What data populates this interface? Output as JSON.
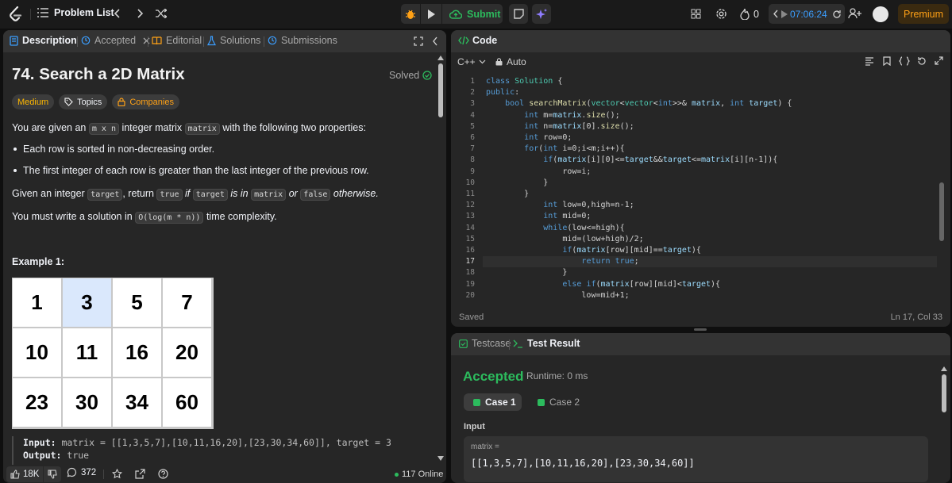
{
  "topbar": {
    "problem_list": "Problem List",
    "submit": "Submit",
    "streak": "0",
    "timer": "07:06:24",
    "premium": "Premium"
  },
  "left_tabs": {
    "description": "Description",
    "accepted": "Accepted",
    "editorial": "Editorial",
    "solutions": "Solutions",
    "submissions": "Submissions"
  },
  "problem": {
    "title": "74. Search a 2D Matrix",
    "solved": "Solved",
    "tags": {
      "difficulty": "Medium",
      "topics": "Topics",
      "companies": "Companies"
    },
    "p1_a": "You are given an",
    "p1_code1": "m x n",
    "p1_b": "integer matrix",
    "p1_code2": "matrix",
    "p1_c": "with the following two properties:",
    "bullet1": "Each row is sorted in non-decreasing order.",
    "bullet2": "The first integer of each row is greater than the last integer of the previous row.",
    "p2_a": "Given an integer",
    "p2_code1": "target",
    "p2_b": ", return",
    "p2_code2": "true",
    "p2_c": "if",
    "p2_code3": "target",
    "p2_d": "is in",
    "p2_code4": "matrix",
    "p2_e": "or",
    "p2_code5": "false",
    "p2_f": "otherwise.",
    "p3_a": "You must write a solution in",
    "p3_code": "O(log(m * n))",
    "p3_b": "time complexity.",
    "example_heading": "Example 1:",
    "matrix_cells": [
      "1",
      "3",
      "5",
      "7",
      "10",
      "11",
      "16",
      "20",
      "23",
      "30",
      "34",
      "60"
    ],
    "input_label": "Input:",
    "input_value": "matrix = [[1,3,5,7],[10,11,16,20],[23,30,34,60]], target = 3",
    "output_label": "Output:",
    "output_value": "true"
  },
  "left_footer": {
    "likes": "18K",
    "comments": "372",
    "online": "117 Online"
  },
  "code_panel": {
    "title": "Code",
    "language": "C++",
    "mode": "Auto",
    "saved": "Saved",
    "cursor": "Ln 17, Col 33",
    "line_numbers": [
      "1",
      "2",
      "3",
      "4",
      "5",
      "6",
      "7",
      "8",
      "9",
      "10",
      "11",
      "12",
      "13",
      "14",
      "15",
      "16",
      "17",
      "18",
      "19",
      "20"
    ],
    "lines": [
      "class Solution {",
      "public:",
      "    bool searchMatrix(vector<vector<int>>& matrix, int target) {",
      "        int m=matrix.size();",
      "        int n=matrix[0].size();",
      "        int row=0;",
      "        for(int i=0;i<m;i++){",
      "            if(matrix[i][0]<=target&&target<=matrix[i][n-1]){",
      "                row=i;",
      "            }",
      "        }",
      "            int low=0,high=n-1;",
      "            int mid=0;",
      "            while(low<=high){",
      "                mid=(low+high)/2;",
      "                if(matrix[row][mid]==target){",
      "                    return true;",
      "                }",
      "                else if(matrix[row][mid]<target){",
      "                    low=mid+1;"
    ]
  },
  "result_panel": {
    "tab_testcase": "Testcase",
    "tab_result": "Test Result",
    "status": "Accepted",
    "runtime": "Runtime: 0 ms",
    "case1": "Case 1",
    "case2": "Case 2",
    "input_label": "Input",
    "var_name": "matrix =",
    "var_value": "[[1,3,5,7],[10,11,16,20],[23,30,34,60]]"
  },
  "colors": {
    "accent_orange": "#ffa116",
    "green": "#2cbb5d",
    "blue_link": "#3b9eff",
    "bg_panel": "#262626"
  }
}
